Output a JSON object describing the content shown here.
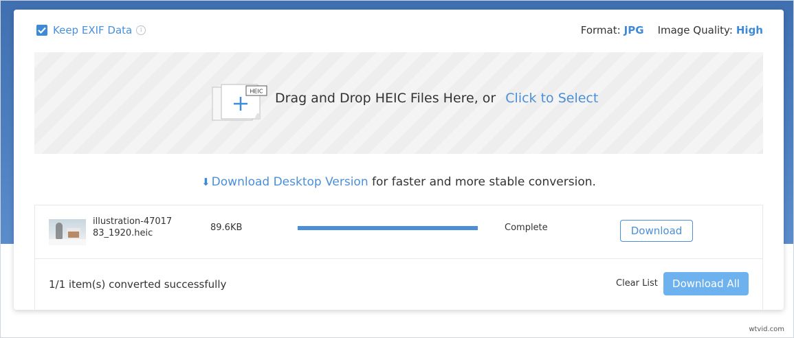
{
  "options": {
    "keep_exif": {
      "label": "Keep EXIF Data",
      "checked": true,
      "info_icon": "info-icon"
    },
    "format": {
      "label": "Format:",
      "value": "JPG"
    },
    "quality": {
      "label": "Image Quality:",
      "value": "High"
    }
  },
  "dropzone": {
    "icon": "heic-add-file-icon",
    "badge": "HEIC",
    "text": "Drag and Drop HEIC Files Here, or",
    "link": "Click to Select"
  },
  "desktop": {
    "icon": "arrow-down-icon",
    "link": "Download Desktop Version",
    "text": " for faster and more stable conversion."
  },
  "files": [
    {
      "name": "illustration-4701783_1920.heic",
      "size": "89.6KB",
      "progress": 1.0,
      "status": "Complete",
      "action": "Download"
    }
  ],
  "footer": {
    "summary": "1/1 item(s) converted successfully",
    "clear": "Clear List",
    "download_all": "Download All"
  },
  "watermark": "wtvid.com",
  "colors": {
    "accent": "#4a8fd8",
    "primary_button": "#6db2ef",
    "background_blue": "#4d7fc0"
  }
}
